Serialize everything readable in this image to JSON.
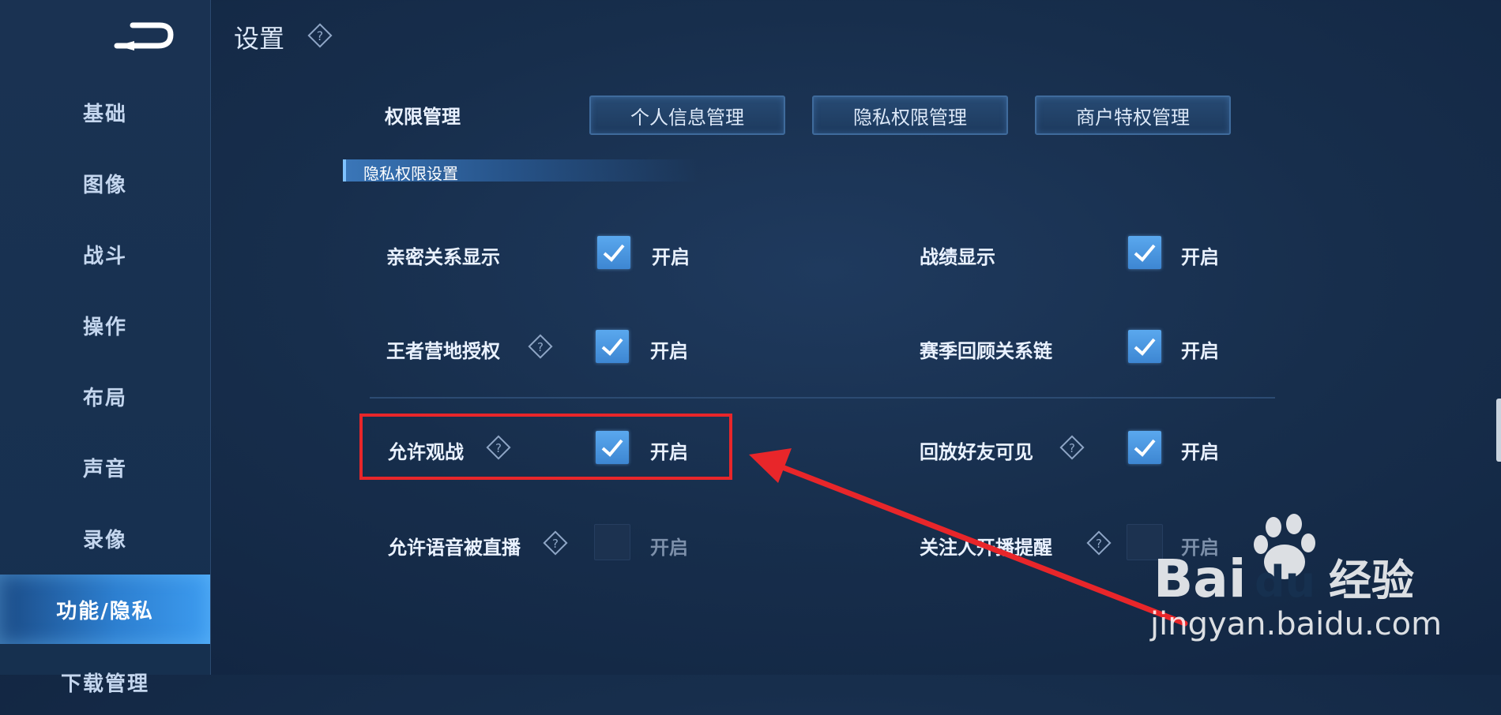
{
  "sidebar": {
    "items": [
      {
        "label": "基础"
      },
      {
        "label": "图像"
      },
      {
        "label": "战斗"
      },
      {
        "label": "操作"
      },
      {
        "label": "布局"
      },
      {
        "label": "声音"
      },
      {
        "label": "录像"
      },
      {
        "label": "功能/隐私",
        "active": true
      },
      {
        "label": "下载管理"
      }
    ]
  },
  "header": {
    "title": "设置"
  },
  "permissions": {
    "label": "权限管理",
    "buttons": [
      "个人信息管理",
      "隐私权限管理",
      "商户特权管理"
    ]
  },
  "section": {
    "title": "隐私权限设置"
  },
  "options": [
    {
      "label": "亲密关系显示",
      "state": "开启",
      "checked": true
    },
    {
      "label": "战绩显示",
      "state": "开启",
      "checked": true
    },
    {
      "label": "王者营地授权",
      "state": "开启",
      "checked": true
    },
    {
      "label": "赛季回顾关系链",
      "state": "开启",
      "checked": true
    },
    {
      "label": "允许观战",
      "state": "开启",
      "checked": true
    },
    {
      "label": "回放好友可见",
      "state": "开启",
      "checked": true
    },
    {
      "label": "允许语音被直播",
      "state": "开启",
      "checked": false
    },
    {
      "label": "关注人开播提醒",
      "state": "开启",
      "checked": false
    }
  ],
  "watermark": {
    "brand": "Bai",
    "brand2": "du",
    "brand_cn": "经验",
    "url": "jingyan.baidu.com"
  },
  "colors": {
    "accent": "#3d86d2",
    "highlight": "#e8262a",
    "background": "#172e4c"
  }
}
